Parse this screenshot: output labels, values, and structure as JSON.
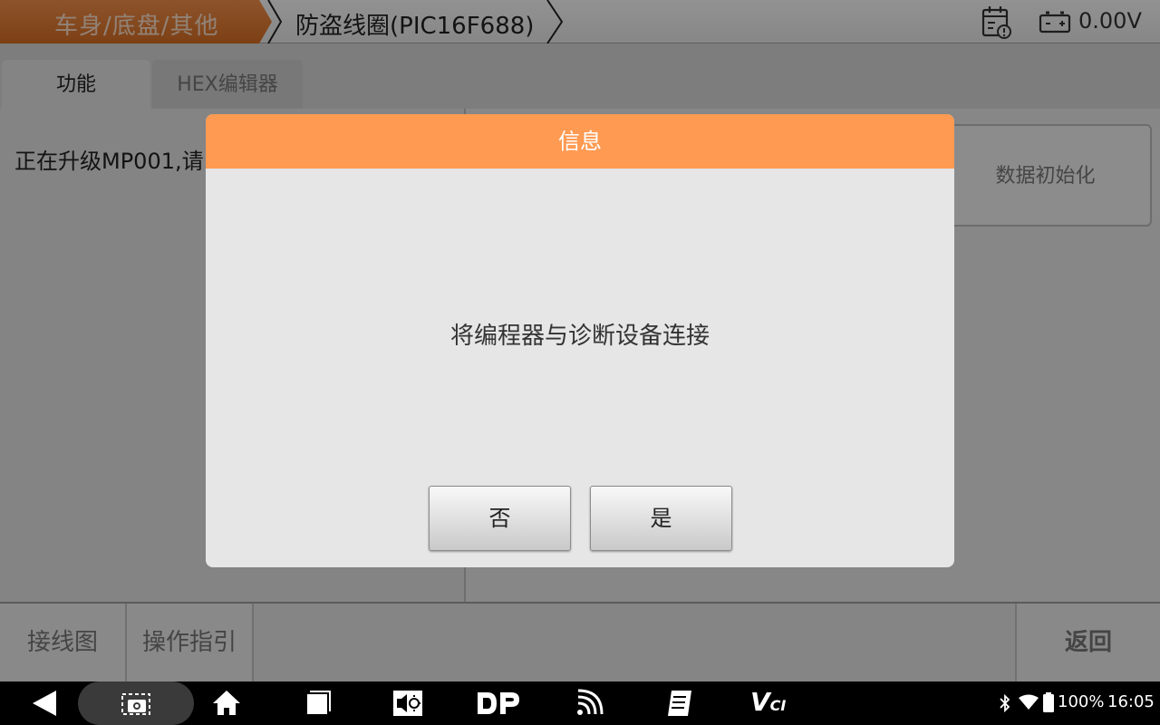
{
  "header": {
    "breadcrumb_root": "车身/底盘/其他",
    "breadcrumb_current": "防盗线圈(PIC16F688)",
    "voltage": "0.00V"
  },
  "tabs": [
    {
      "label": "功能",
      "active": true
    },
    {
      "label": "HEX编辑器",
      "active": false
    }
  ],
  "content": {
    "status_text": "正在升级MP001,请",
    "data_init_button": "数据初始化"
  },
  "dialog": {
    "title": "信息",
    "message": "将编程器与诊断设备连接",
    "no_label": "否",
    "yes_label": "是"
  },
  "toolbar": {
    "wiring_label": "接线图",
    "guide_label": "操作指引",
    "back_label": "返回"
  },
  "navbar": {
    "icons": [
      "back-icon",
      "screenshot-icon",
      "home-icon",
      "recent-apps-icon",
      "brightness-icon",
      "dp-icon",
      "wifi-icon",
      "notes-icon",
      "vci-icon"
    ],
    "vci_text": "V",
    "vci_sub": "CI",
    "battery": "100%",
    "time": "16:05"
  },
  "colors": {
    "accent_orange": "#ff9a52",
    "breadcrumb_orange": "#e07a30"
  }
}
